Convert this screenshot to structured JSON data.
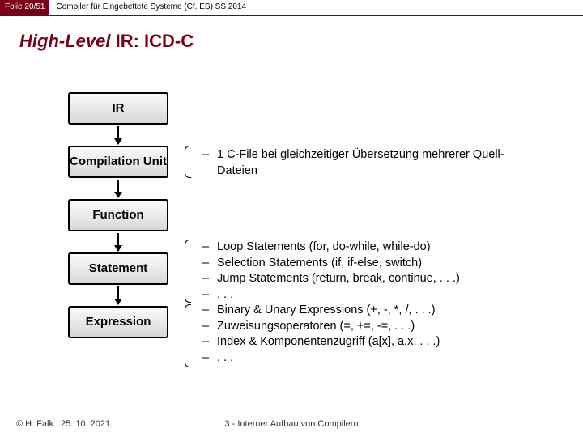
{
  "header": {
    "folie": "Folie 20/51",
    "course": "Compiler für Eingebettete Systeme (Cf. ES) SS 2014"
  },
  "title_italic": "High-Level",
  "title_rest": " IR: ICD-C",
  "nodes": {
    "ir": "IR",
    "cu": "Compilation Unit",
    "fn": "Function",
    "stmt": "Statement",
    "expr": "Expression"
  },
  "desc_cu": [
    "1 C-File bei gleichzeitiger Übersetzung mehrerer Quell-Dateien"
  ],
  "desc_stmt": [
    "Loop Statements (for, do-while, while-do)",
    "Selection Statements (if, if-else, switch)",
    "Jump Statements (return, break, continue, . . .)",
    ". . .",
    "Binary & Unary Expressions (+, -, *, /, . . .)",
    "Zuweisungsoperatoren (=, +=, -=, . . .)",
    "Index & Komponentenzugriff (a[x], a.x, . . .)",
    ". . ."
  ],
  "footer": {
    "left": "© H. Falk | 25. 10. 2021",
    "center": "3 - Interner Aufbau von Compilern"
  }
}
